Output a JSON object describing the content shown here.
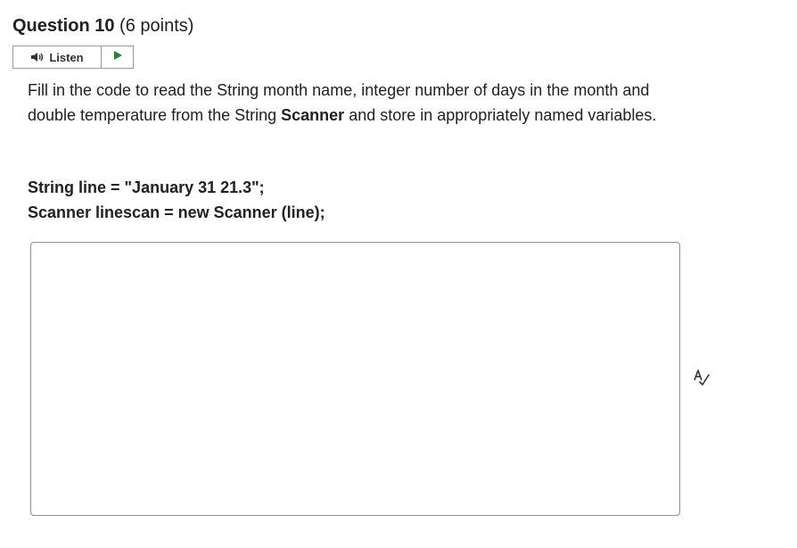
{
  "question": {
    "title": "Question 10",
    "points": "(6 points)"
  },
  "listen": {
    "label": "Listen"
  },
  "prompt": {
    "part1": "Fill in the code to read the String month name, integer number of days in the month and double temperature from the String ",
    "bold_word": "Scanner",
    "part2": " and store in appropriately named variables."
  },
  "code": {
    "line1": "String line = \"January 31 21.3\";",
    "line2": "Scanner linescan = new Scanner (line);"
  },
  "answer": {
    "value": "",
    "placeholder": ""
  },
  "icons": {
    "speaker": "speaker-icon",
    "play": "play-icon",
    "spellcheck": "spellcheck-icon"
  },
  "colors": {
    "play_green": "#2e7d32",
    "text": "#202122"
  }
}
